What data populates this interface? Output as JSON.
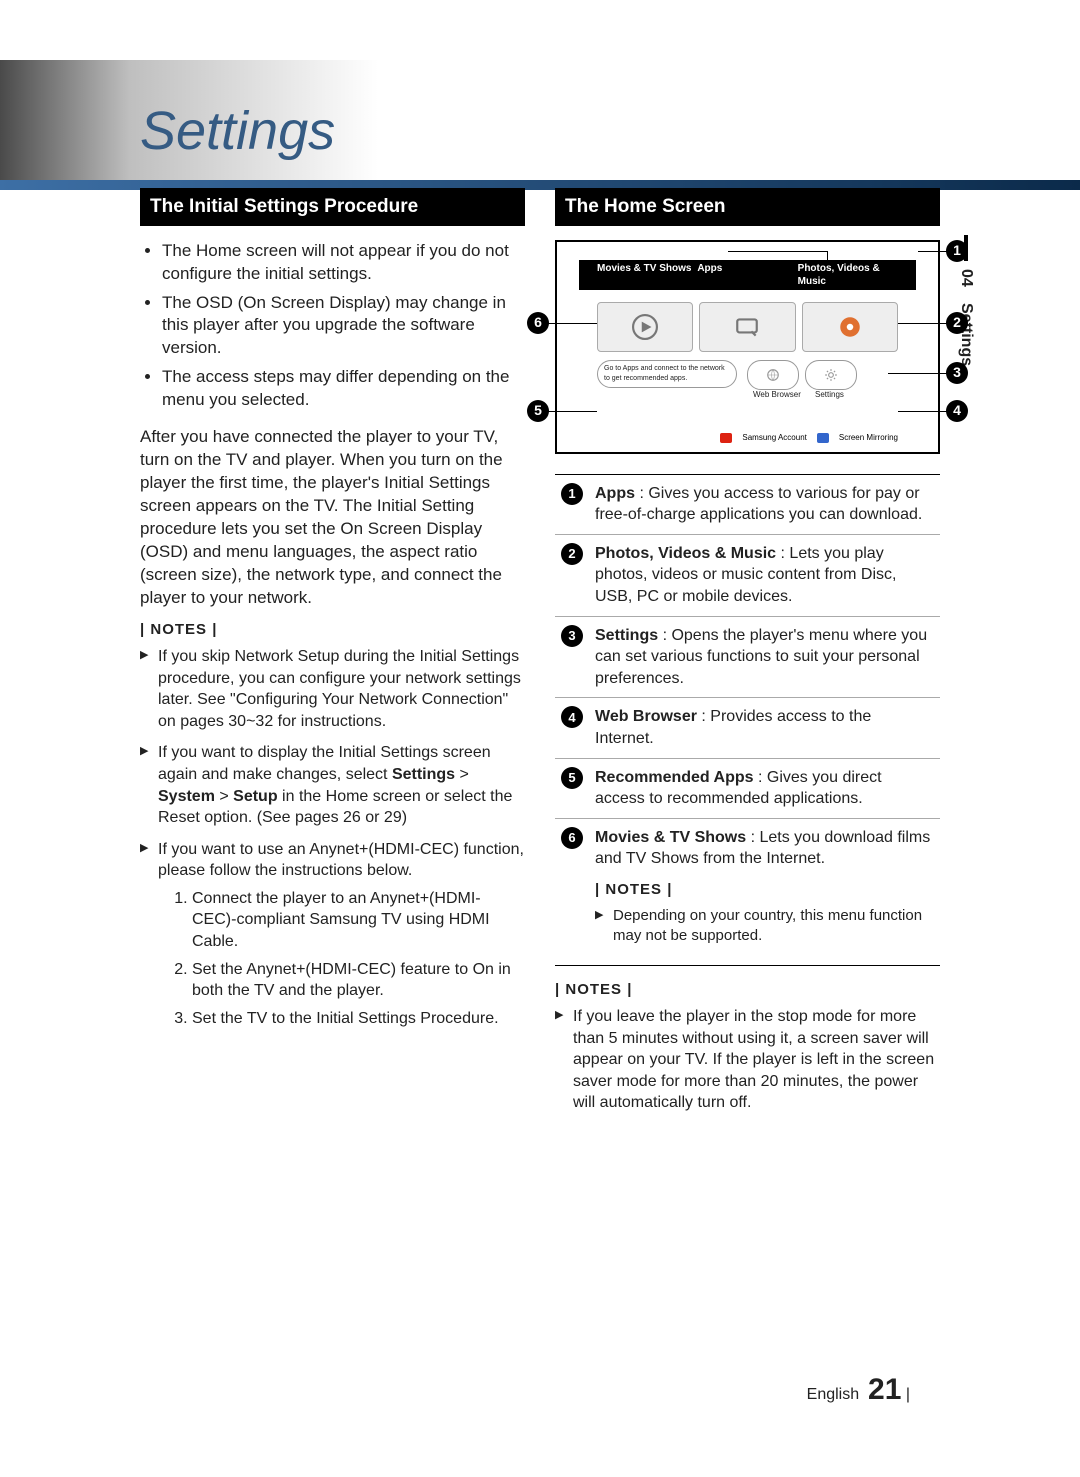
{
  "chapter_tab": {
    "num": "04",
    "label": "Settings"
  },
  "title": "Settings",
  "left": {
    "heading": "The Initial Settings Procedure",
    "bullets": [
      "The Home screen will not appear if you do not configure the initial settings.",
      "The OSD (On Screen Display) may change in this player after you upgrade the software version.",
      "The access steps may differ depending on the menu you selected."
    ],
    "para": "After you have connected the player to your TV, turn on the TV and player. When you turn on the player the first time, the player's Initial Settings screen appears on the TV. The Initial Setting procedure lets you set the On Screen Display (OSD) and menu languages, the aspect ratio (screen size), the network type, and connect the player to your network.",
    "notes_label": "| NOTES |",
    "notes": [
      "If you skip Network Setup during the Initial Settings procedure, you can configure your network settings later. See \"Configuring Your Network Connection\" on pages 30~32 for instructions.",
      "If you want to display the Initial Settings screen again and make changes, select <b>Settings</b> > <b>System</b> > <b>Setup</b> in the Home screen or select the Reset option. (See pages 26 or 29)",
      "If you want to use an Anynet+(HDMI-CEC) function, please follow the instructions below."
    ],
    "subnum": [
      "Connect the player to an Anynet+(HDMI-CEC)-compliant Samsung TV using HDMI Cable.",
      "Set the Anynet+(HDMI-CEC) feature to On in both the TV and the player.",
      "Set the TV to the Initial Settings Procedure."
    ]
  },
  "right": {
    "heading": "The Home Screen",
    "diagram": {
      "tiles": [
        "Movies & TV Shows",
        "Apps",
        "Photos, Videos & Music"
      ],
      "rec": "Go to Apps and connect to the network to get recommended apps.",
      "pill1": "Web Browser",
      "pill2": "Settings",
      "bottom": [
        {
          "key_color": "#d21",
          "label": "Samsung Account"
        },
        {
          "key_color": "#36c",
          "label": "Screen Mirroring"
        }
      ],
      "callouts": [
        "1",
        "2",
        "3",
        "4",
        "5",
        "6"
      ]
    },
    "legend": [
      {
        "n": "1",
        "html": "<b>Apps</b> : Gives you access to various for pay or free-of-charge applications you can download."
      },
      {
        "n": "2",
        "html": "<b>Photos, Videos & Music</b> : Lets you play photos, videos or music content from Disc, USB, PC or mobile devices."
      },
      {
        "n": "3",
        "html": "<b>Settings</b> : Opens the player's menu where you can set various functions to suit your personal preferences."
      },
      {
        "n": "4",
        "html": "<b>Web Browser</b> : Provides access to the Internet."
      },
      {
        "n": "5",
        "html": "<b>Recommended Apps</b> : Gives you direct access to recommended applications."
      },
      {
        "n": "6",
        "html": "<b>Movies & TV Shows</b> : Lets you download films and TV Shows from the Internet.",
        "notes_label": "| NOTES |",
        "note": "Depending on your country, this menu function may not be supported."
      }
    ],
    "foot_notes_label": "| NOTES |",
    "foot_note": "If you leave the player in the stop mode for more than 5 minutes without using it, a screen saver will appear on your TV. If the player is left in the screen saver mode for more than 20 minutes, the power will automatically turn off."
  },
  "footer": {
    "lang": "English",
    "page": "21"
  }
}
